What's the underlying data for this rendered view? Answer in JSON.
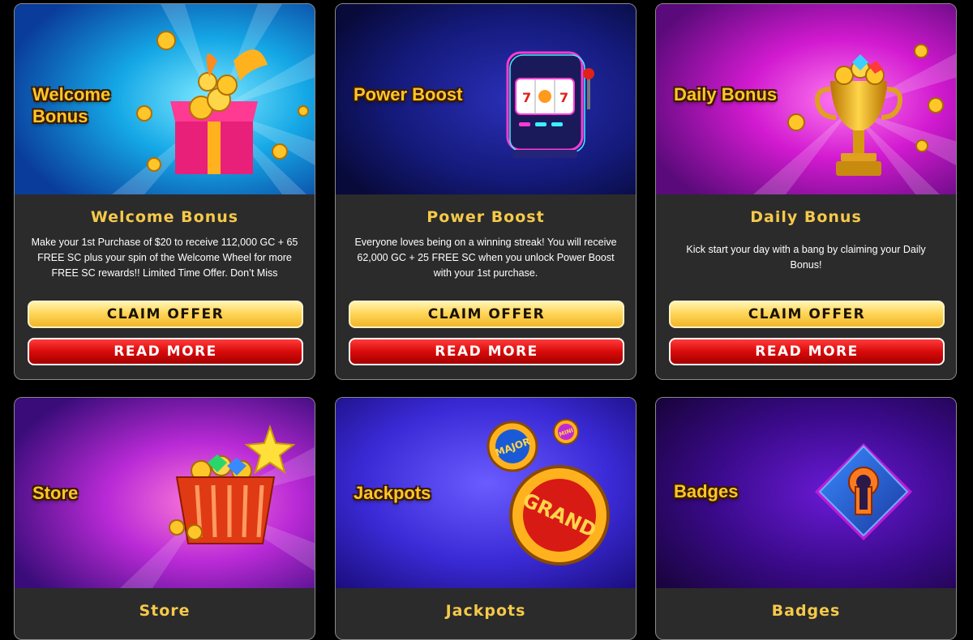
{
  "cards": [
    {
      "banner_title": "Welcome Bonus",
      "title": "Welcome Bonus",
      "description": "Make your 1st Purchase of $20 to receive 112,000 GC + 65 FREE SC plus your spin of the Welcome Wheel for more FREE SC rewards!! Limited Time Offer. Don’t Miss",
      "claim_label": "CLAIM OFFER",
      "read_label": "READ MORE",
      "icon": "gift-box-with-coins-icon"
    },
    {
      "banner_title": "Power Boost",
      "title": "Power Boost",
      "description": "Everyone loves being on a winning streak! You will receive 62,000 GC + 25 FREE SC when you unlock Power Boost with your 1st purchase.",
      "claim_label": "CLAIM OFFER",
      "read_label": "READ MORE",
      "icon": "slot-machine-icon"
    },
    {
      "banner_title": "Daily Bonus",
      "title": "Daily Bonus",
      "description": "Kick start your day with a bang by claiming your Daily Bonus!",
      "claim_label": "CLAIM OFFER",
      "read_label": "READ MORE",
      "icon": "trophy-cup-icon"
    },
    {
      "banner_title": "Store",
      "title": "Store",
      "icon": "basket-with-coins-icon"
    },
    {
      "banner_title": "Jackpots",
      "title": "Jackpots",
      "icon": "jackpot-medals-icon",
      "medal_labels": [
        "MAJOR",
        "MINI",
        "GRAND"
      ]
    },
    {
      "banner_title": "Badges",
      "title": "Badges",
      "icon": "keyhole-badge-icon"
    }
  ],
  "colors": {
    "page_bg": "#000000",
    "card_bg": "#2b2b2b",
    "title_gold": "#f5c94a",
    "claim_gold": "#ffd65a",
    "read_red": "#d90a0a"
  }
}
